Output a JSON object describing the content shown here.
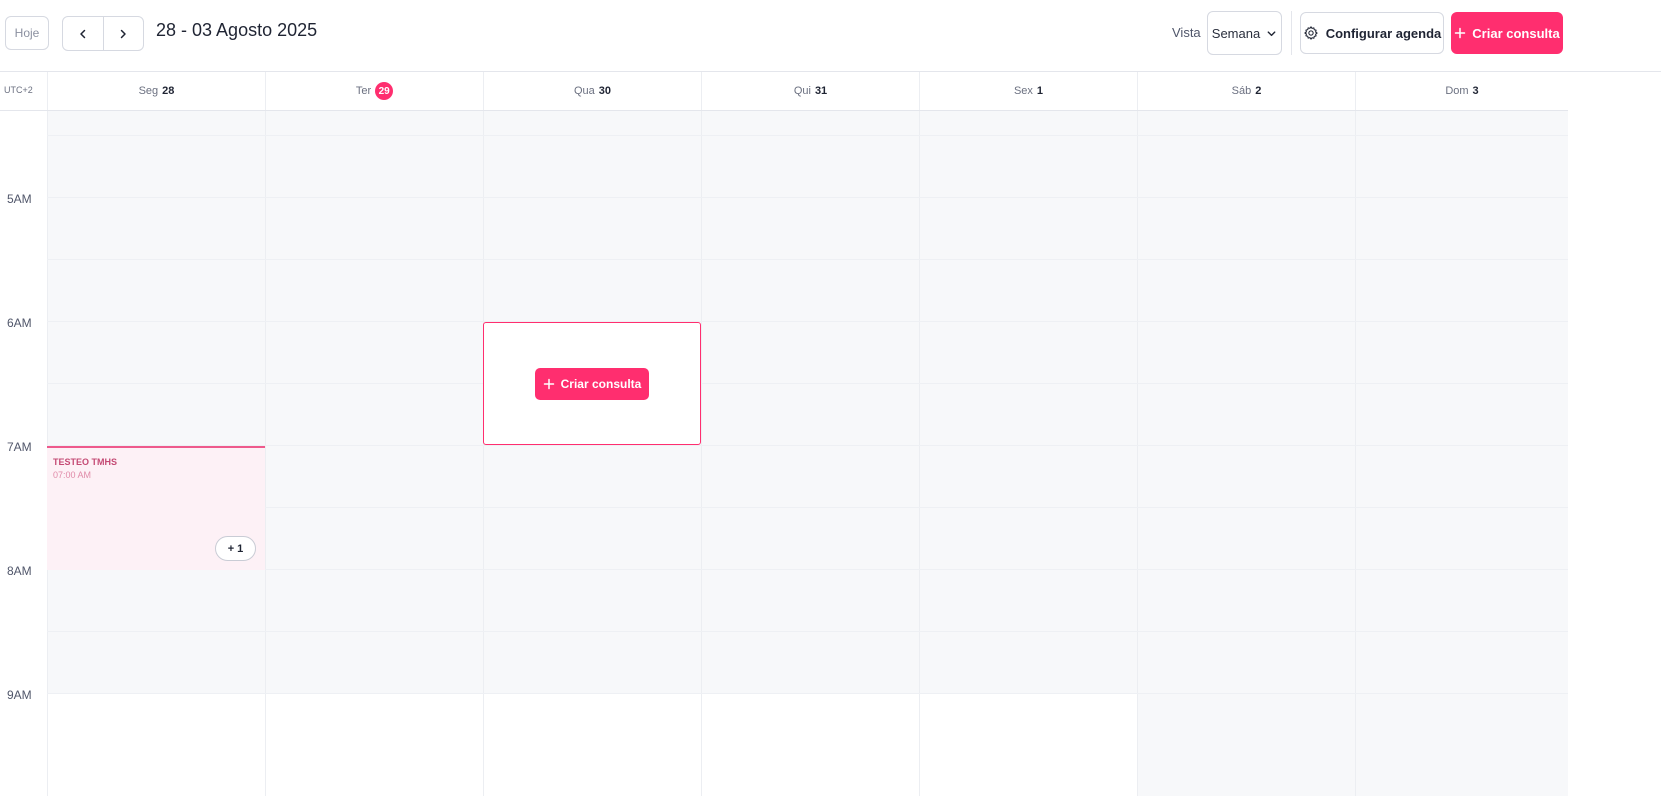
{
  "toolbar": {
    "today_label": "Hoje",
    "range_title": "28 - 03 Agosto 2025",
    "view_label": "Vista",
    "view_selected": "Semana",
    "config_label": "Configurar agenda",
    "create_label": "Criar consulta"
  },
  "calendar": {
    "timezone": "UTC+2",
    "days": [
      {
        "name": "Seg",
        "num": "28",
        "today": false
      },
      {
        "name": "Ter",
        "num": "29",
        "today": true
      },
      {
        "name": "Qua",
        "num": "30",
        "today": false
      },
      {
        "name": "Qui",
        "num": "31",
        "today": false
      },
      {
        "name": "Sex",
        "num": "1",
        "today": false
      },
      {
        "name": "Sáb",
        "num": "2",
        "today": false
      },
      {
        "name": "Dom",
        "num": "3",
        "today": false
      }
    ],
    "hours": [
      "5AM",
      "6AM",
      "7AM",
      "8AM",
      "9AM"
    ],
    "slot_create_label": "Criar consulta",
    "event": {
      "title": "TESTEO TMHS",
      "time": "07:00 AM",
      "more": "+ 1"
    }
  },
  "colors": {
    "accent": "#ff2e6f",
    "offhours_bg": "#f7f8fa",
    "event_bg": "#fdf1f6"
  }
}
